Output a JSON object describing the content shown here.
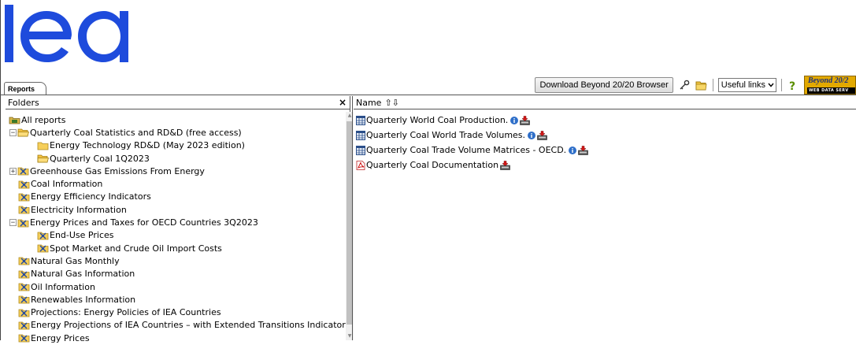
{
  "brand": {
    "logo_text": "iea",
    "logo_color": "#1e4bdc"
  },
  "tabs": {
    "active_label": "Reports"
  },
  "toolbar": {
    "download_button": "Download Beyond 20/20 Browser",
    "useful_links": "Useful links",
    "beyond_line1": "Beyond 20/2",
    "beyond_line2": "WEB DATA SERV"
  },
  "folders_panel": {
    "header": "Folders",
    "close_glyph": "×",
    "items": [
      {
        "label": "All reports",
        "level": 0,
        "icon": "all-reports-icon",
        "toggle": ""
      },
      {
        "label": "Quarterly Coal Statistics and RD&D (free access)",
        "level": 0,
        "icon": "folder-open-icon",
        "toggle": "−"
      },
      {
        "label": "Energy Technology RD&D (May 2023 edition)",
        "level": 1,
        "icon": "folder-icon",
        "toggle": ""
      },
      {
        "label": "Quarterly Coal 1Q2023",
        "level": 1,
        "icon": "folder-open-icon",
        "toggle": ""
      },
      {
        "label": "Greenhouse Gas Emissions From Energy",
        "level": 0,
        "icon": "locked-folder-icon",
        "toggle": "+"
      },
      {
        "label": "Coal Information",
        "level": 0,
        "icon": "locked-folder-icon",
        "toggle": ""
      },
      {
        "label": "Energy Efficiency Indicators",
        "level": 0,
        "icon": "locked-folder-icon",
        "toggle": ""
      },
      {
        "label": "Electricity Information",
        "level": 0,
        "icon": "locked-folder-icon",
        "toggle": ""
      },
      {
        "label": "Energy Prices and Taxes for OECD Countries 3Q2023",
        "level": 0,
        "icon": "locked-folder-icon",
        "toggle": "−"
      },
      {
        "label": "End-Use Prices",
        "level": 1,
        "icon": "locked-folder-icon",
        "toggle": ""
      },
      {
        "label": "Spot Market and Crude Oil Import Costs",
        "level": 1,
        "icon": "locked-folder-icon",
        "toggle": ""
      },
      {
        "label": "Natural Gas Monthly",
        "level": 0,
        "icon": "locked-folder-icon",
        "toggle": ""
      },
      {
        "label": "Natural Gas Information",
        "level": 0,
        "icon": "locked-folder-icon",
        "toggle": ""
      },
      {
        "label": "Oil Information",
        "level": 0,
        "icon": "locked-folder-icon",
        "toggle": ""
      },
      {
        "label": "Renewables Information",
        "level": 0,
        "icon": "locked-folder-icon",
        "toggle": ""
      },
      {
        "label": "Projections: Energy Policies of IEA Countries",
        "level": 0,
        "icon": "locked-folder-icon",
        "toggle": ""
      },
      {
        "label": "Energy Projections of IEA Countries – with Extended Transitions Indicators.",
        "level": 0,
        "icon": "locked-folder-icon",
        "toggle": ""
      },
      {
        "label": "Energy Prices",
        "level": 0,
        "icon": "locked-folder-icon",
        "toggle": ""
      }
    ]
  },
  "reports_panel": {
    "name_header": "Name",
    "sort_glyph": "⇧⇩",
    "items": [
      {
        "label": "Quarterly World Coal Production.",
        "icon": "table-report-icon",
        "info": true,
        "download": true
      },
      {
        "label": "Quarterly Coal World Trade Volumes.",
        "icon": "table-report-icon",
        "info": true,
        "download": true
      },
      {
        "label": "Quarterly Coal Trade Volume Matrices - OECD.",
        "icon": "table-report-icon",
        "info": true,
        "download": true
      },
      {
        "label": "Quarterly Coal Documentation",
        "icon": "pdf-icon",
        "info": false,
        "download": true
      }
    ]
  }
}
